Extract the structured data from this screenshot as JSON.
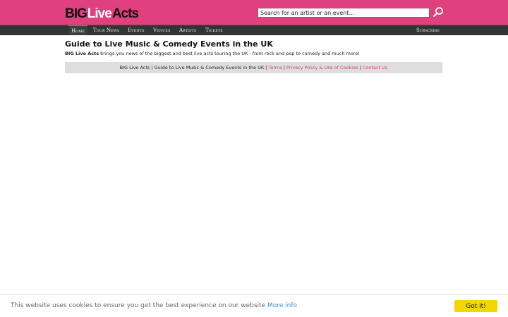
{
  "header": {
    "logo": {
      "big": "BIG",
      "live": "Live",
      "acts": "Acts"
    },
    "search": {
      "placeholder": "Search for an artist or an event...",
      "value": "",
      "button_icon": "search-icon"
    },
    "brand_color": "#e0407e"
  },
  "nav": {
    "items": [
      {
        "label": "Home",
        "active": true
      },
      {
        "label": "Tour News"
      },
      {
        "label": "Events"
      },
      {
        "label": "Venues"
      },
      {
        "label": "Artists"
      },
      {
        "label": "Tickets"
      }
    ],
    "subscribe": "Subscribe"
  },
  "main": {
    "title": "Guide to Live Music & Comedy Events in the UK",
    "intro_brand": "BIG Live Acts",
    "intro_text": " brings you news of the biggest and best live acts touring the UK - from rock and pop to comedy and much more!"
  },
  "footer": {
    "text": "BIG Live Acts | Guide to Live Music & Comedy Events in the UK |",
    "terms": "Terms",
    "sep1": "|",
    "privacy": "Privacy Policy & Use of Cookies",
    "sep2": "|",
    "contact": "Contact Us"
  },
  "cookie": {
    "text": "This website uses cookies to ensure you get the best experience on our website",
    "more": "More info",
    "button": "Got it!",
    "button_color": "#f1d600"
  }
}
